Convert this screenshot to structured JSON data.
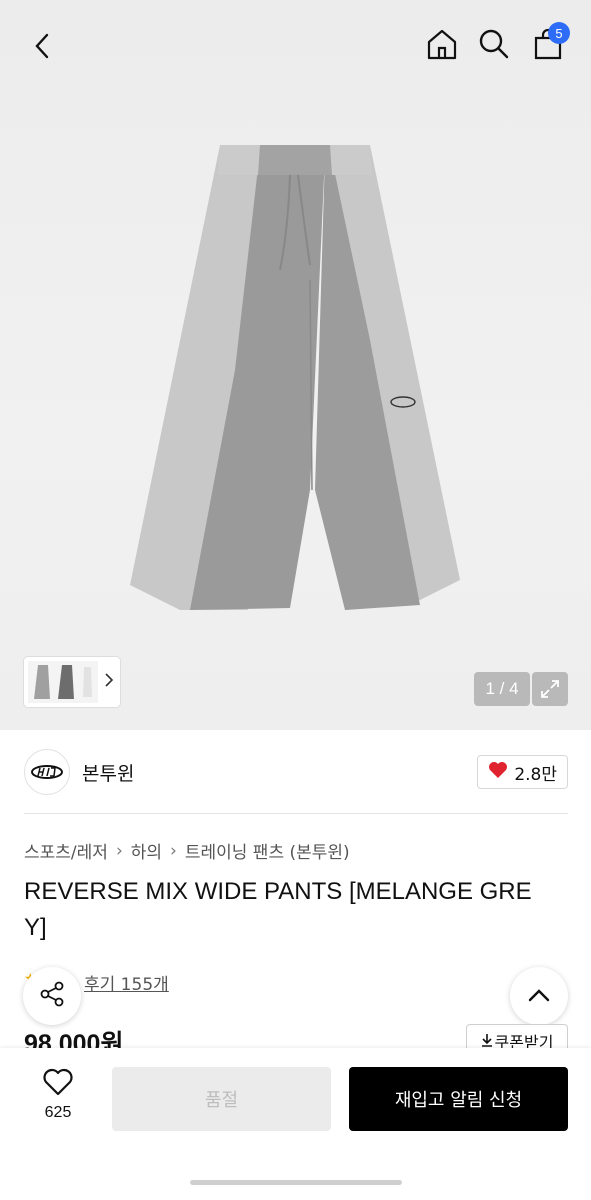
{
  "header": {
    "icons": [
      "back-icon",
      "home-icon",
      "search-icon",
      "shopping-bag-icon"
    ],
    "cart_count": "5"
  },
  "gallery": {
    "counter": "1 / 4",
    "background": "#eeeeee"
  },
  "brand": {
    "name": "본투윈",
    "likes": "2.8만",
    "heart_color": "#e0242f"
  },
  "breadcrumb": [
    "스포츠/레저",
    "하의",
    "트레이닝 팬츠 (본투윈)"
  ],
  "product": {
    "title": "REVERSE MIX WIDE PANTS [MELANGE GREY]",
    "review_label": "후기 155개",
    "price": "98,000원",
    "coupon_label": "쿠폰받기"
  },
  "bottom_bar": {
    "wish_count": "625",
    "soldout_label": "품절",
    "restock_label": "재입고 알림 신청",
    "primary_color": "#000000"
  }
}
